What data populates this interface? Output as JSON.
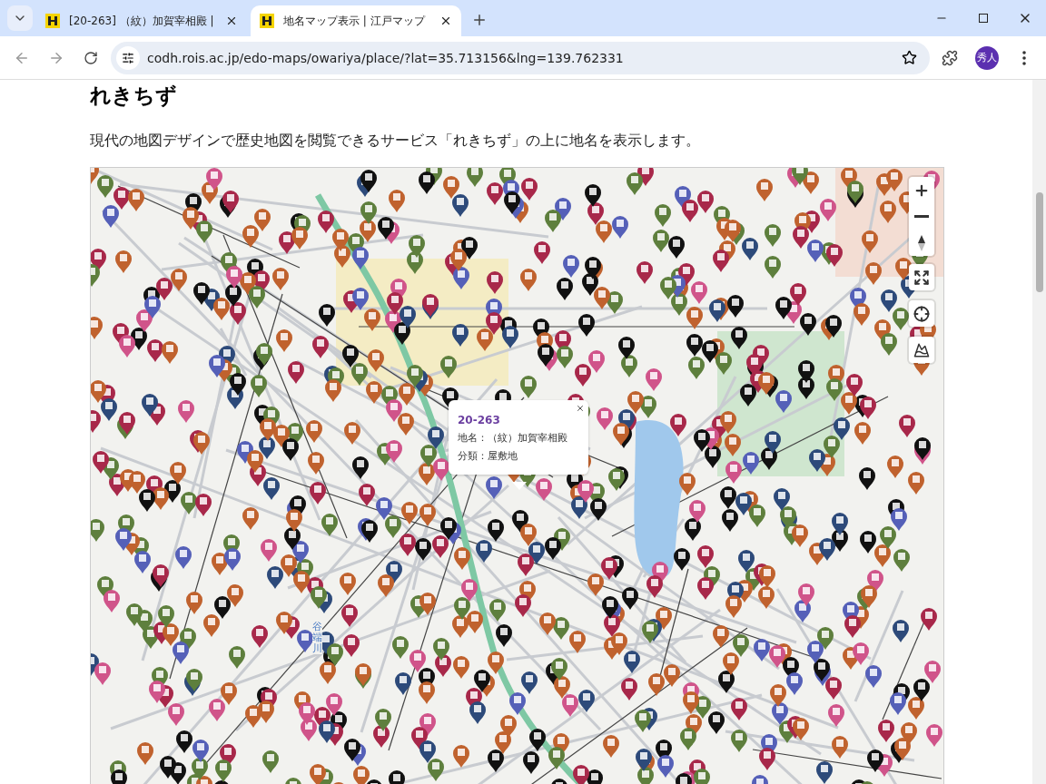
{
  "browser": {
    "tabs": [
      {
        "title": "[20-263] （紋）加賀宰相殿 |",
        "selected": false
      },
      {
        "title": "地名マップ表示 | 江戸マップ",
        "selected": true
      }
    ],
    "url": "codh.rois.ac.jp/edo-maps/owariya/place/?lat=35.713156&lng=139.762331",
    "profile": "秀人"
  },
  "section": {
    "heading": "れきちず",
    "description": "現代の地図デザインで歴史地図を閲覧できるサービス「れきちず」の上に地名を表示します。"
  },
  "map": {
    "river_label": "谷端川",
    "popup": {
      "id": "20-263",
      "lines": [
        "地名：（紋）加賀宰相殿",
        "分類：屋敷地"
      ]
    }
  }
}
